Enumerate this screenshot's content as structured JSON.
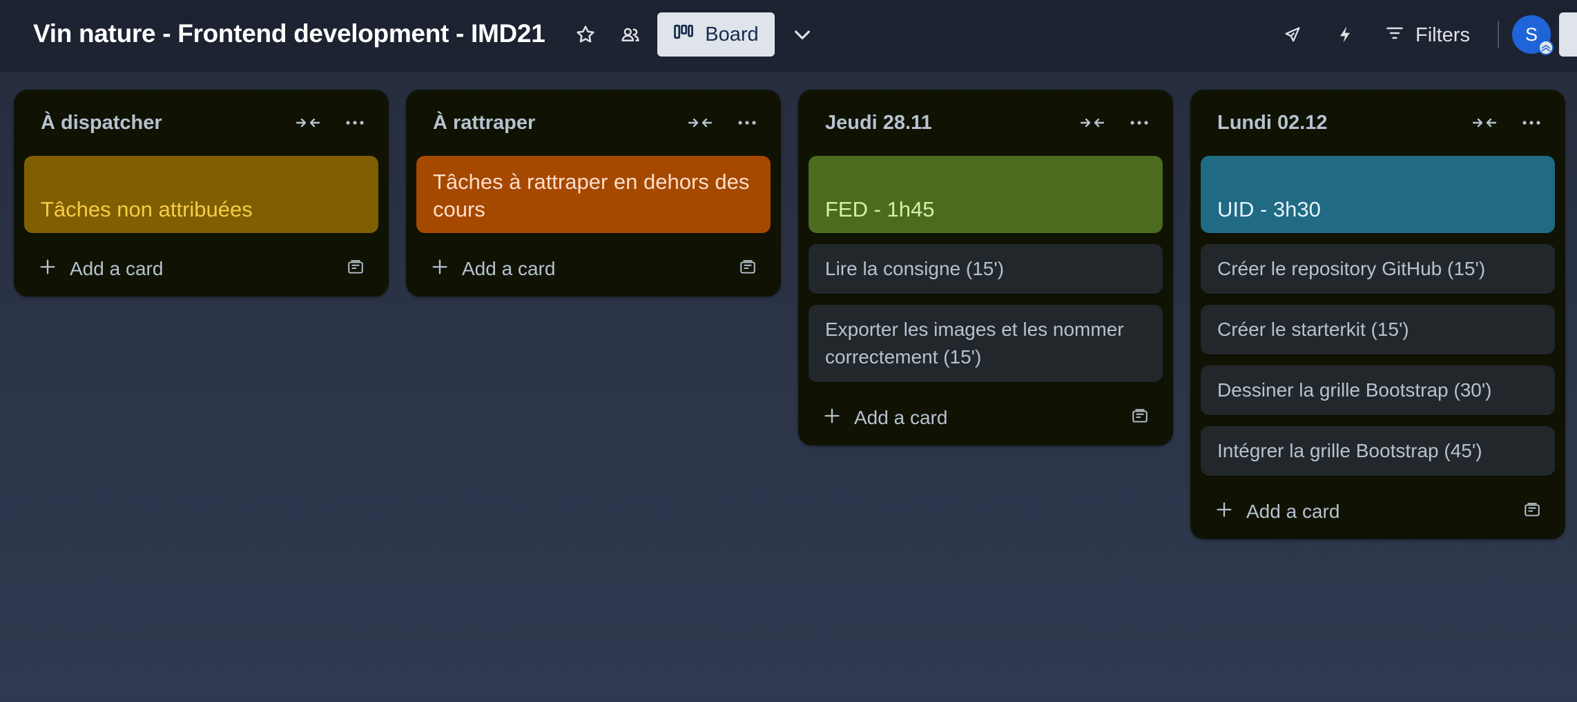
{
  "header": {
    "board_title": "Vin nature - Frontend development - IMD21",
    "view_label": "Board",
    "filters_label": "Filters",
    "avatar_initial": "S"
  },
  "lists": [
    {
      "title": "À dispatcher",
      "cards": [
        {
          "text": "Tâches non attribuées",
          "cover_color": "#7f5f01",
          "text_color": "#f5cd47",
          "cover": true
        }
      ],
      "add_label": "Add a card"
    },
    {
      "title": "À rattraper",
      "cards": [
        {
          "text": "Tâches à rattraper en dehors des cours",
          "cover_color": "#a54800",
          "text_color": "#fedec8",
          "cover": true
        }
      ],
      "add_label": "Add a card"
    },
    {
      "title": "Jeudi 28.11",
      "cards": [
        {
          "text": "FED - 1h45",
          "cover_color": "#4c6b1f",
          "text_color": "#d3f1a7",
          "cover": true
        },
        {
          "text": "Lire la consigne (15')"
        },
        {
          "text": "Exporter les images et les nommer correctement (15')"
        }
      ],
      "add_label": "Add a card"
    },
    {
      "title": "Lundi 02.12",
      "cards": [
        {
          "text": "UID - 3h30",
          "cover_color": "#206a83",
          "text_color": "#e6f3ff",
          "cover": true
        },
        {
          "text": "Créer le repository GitHub (15')"
        },
        {
          "text": "Créer le starterkit (15')"
        },
        {
          "text": "Dessiner la grille Bootstrap (30')"
        },
        {
          "text": "Intégrer la grille Bootstrap (45')"
        }
      ],
      "add_label": "Add a card"
    }
  ],
  "icons": {
    "star": "star-icon",
    "visibility": "team-visibility-icon",
    "board": "board-columns-icon",
    "view_switch": "chevron-down-icon",
    "power_ups": "rocket-icon",
    "automation": "lightning-icon",
    "filter": "filter-icon",
    "collapse": "collapse-list-icon",
    "more": "more-horizontal-icon",
    "add": "plus-icon",
    "template": "card-template-icon"
  },
  "colors": {
    "list_bg": "#101204",
    "card_bg": "#22272b",
    "avatar": "#1f64d8"
  }
}
